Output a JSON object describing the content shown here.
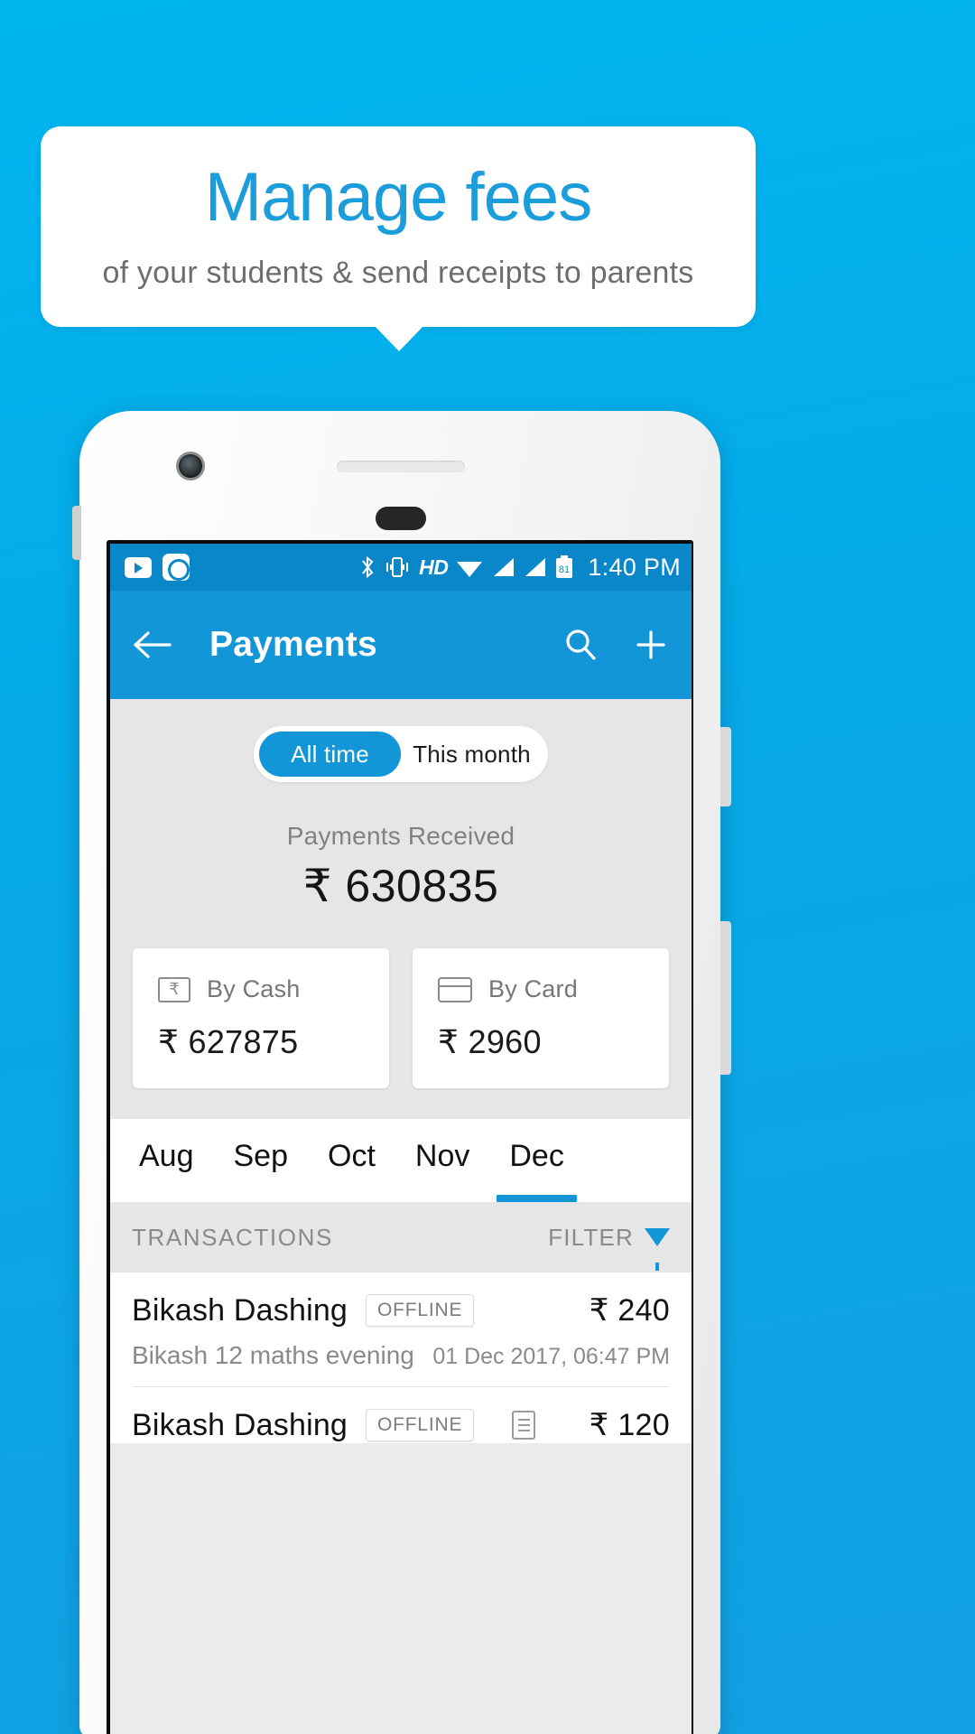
{
  "promo": {
    "title": "Manage fees",
    "subtitle": "of your students & send receipts to parents",
    "accent_color": "#1b9ddb",
    "background_color": "#07a8e8"
  },
  "statusbar": {
    "time": "1:40 PM",
    "hd_label": "HD",
    "battery_level": "81",
    "left_icons": [
      "youtube-icon",
      "screenshot-icon"
    ],
    "right_icons": [
      "bluetooth-icon",
      "vibrate-icon",
      "hd-icon",
      "wifi-icon",
      "signal-icon",
      "signal-icon",
      "battery-icon"
    ]
  },
  "appbar": {
    "title": "Payments",
    "back_icon": "arrow-back-icon",
    "search_icon": "search-icon",
    "add_icon": "plus-icon",
    "color": "#1296d8"
  },
  "summary": {
    "segments": [
      {
        "label": "All time",
        "active": true
      },
      {
        "label": "This month",
        "active": false
      }
    ],
    "received_label": "Payments Received",
    "received_amount": "₹ 630835",
    "cards": [
      {
        "label": "By Cash",
        "amount": "₹ 627875",
        "icon": "rupee-note-icon"
      },
      {
        "label": "By Card",
        "amount": "₹ 2960",
        "icon": "credit-card-icon"
      }
    ]
  },
  "month_tabs": {
    "items": [
      "Aug",
      "Sep",
      "Oct",
      "Nov",
      "Dec"
    ],
    "active": "Dec"
  },
  "transactions": {
    "header": "TRANSACTIONS",
    "filter_label": "FILTER",
    "filter_icon": "funnel-icon",
    "rows": [
      {
        "name": "Bikash Dashing",
        "badge": "OFFLINE",
        "amount": "₹ 240",
        "subtitle": "Bikash 12 maths evening",
        "date": "01 Dec 2017, 06:47 PM",
        "has_receipt": false
      },
      {
        "name": "Bikash Dashing",
        "badge": "OFFLINE",
        "amount": "₹ 120",
        "subtitle": "",
        "date": "",
        "has_receipt": true
      }
    ]
  }
}
